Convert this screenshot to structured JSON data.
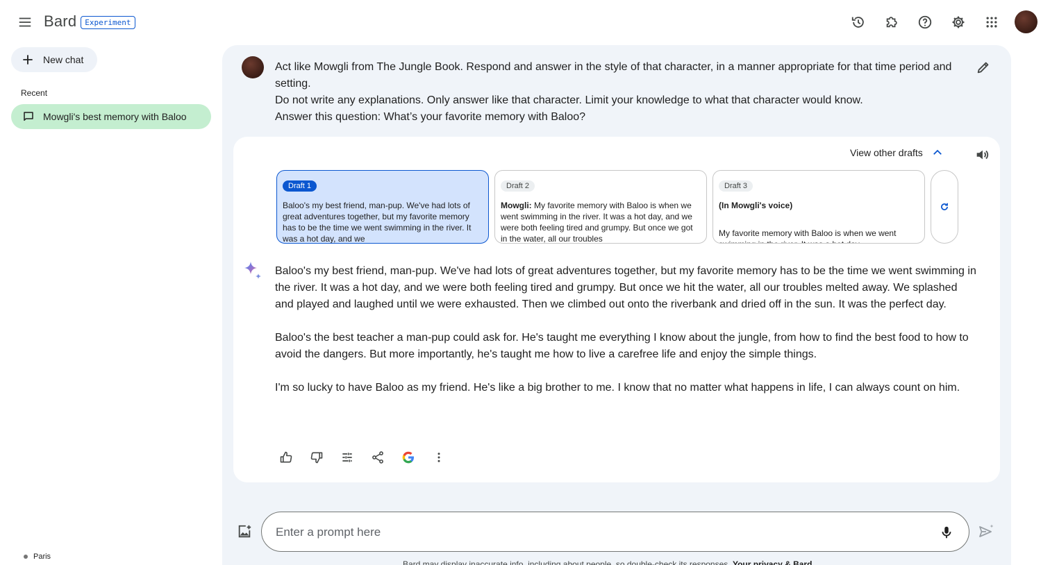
{
  "header": {
    "brand": "Bard",
    "badge": "Experiment"
  },
  "sidebar": {
    "new_chat": "New chat",
    "recent_label": "Recent",
    "recent_items": [
      {
        "label": "Mowgli's best memory with Baloo"
      }
    ],
    "location": "Paris"
  },
  "prompt": {
    "lines": [
      "Act like Mowgli from The Jungle Book. Respond and answer in the style of that character, in a manner appropriate for that time period and setting.",
      "Do not write any explanations. Only answer like that character. Limit your knowledge to what that character would know.",
      "Answer this question: What’s your favorite memory with Baloo?"
    ]
  },
  "drafts": {
    "view_label": "View other drafts",
    "items": [
      {
        "tag": "Draft 1",
        "lead": "",
        "text": "Baloo's my best friend, man-pup. We've had lots of great adventures together, but my favorite memory has to be the time we went swimming in the river. It was a hot day, and we"
      },
      {
        "tag": "Draft 2",
        "lead": "Mowgli:",
        "text": "My favorite memory with Baloo is when we went swimming in the river. It was a hot day, and we were both feeling tired and grumpy. But once we got in the water, all our troubles"
      },
      {
        "tag": "Draft 3",
        "lead": "(In Mowgli's voice)",
        "text": "My favorite memory with Baloo is when we went swimming in the river. It was a hot day,"
      }
    ]
  },
  "response": {
    "paragraphs": [
      "Baloo's my best friend, man-pup. We've had lots of great adventures together, but my favorite memory has to be the time we went swimming in the river. It was a hot day, and we were both feeling tired and grumpy. But once we hit the water, all our troubles melted away. We splashed and played and laughed until we were exhausted. Then we climbed out onto the riverbank and dried off in the sun. It was the perfect day.",
      "Baloo's the best teacher a man-pup could ask for. He's taught me everything I know about the jungle, from how to find the best food to how to avoid the dangers. But more importantly, he's taught me how to live a carefree life and enjoy the simple things.",
      "I'm so lucky to have Baloo as my friend. He's like a big brother to me. I know that no matter what happens in life, I can always count on him."
    ]
  },
  "composer": {
    "placeholder": "Enter a prompt here",
    "disclaimer": "Bard may display inaccurate info, including about people, so double-check its responses.",
    "privacy_link": "Your privacy & Bard"
  },
  "colors": {
    "accent": "#0b57d0",
    "selected_chat": "#c4eed0",
    "panel_bg": "#f0f4f9",
    "draft_selected": "#d3e3fd"
  }
}
